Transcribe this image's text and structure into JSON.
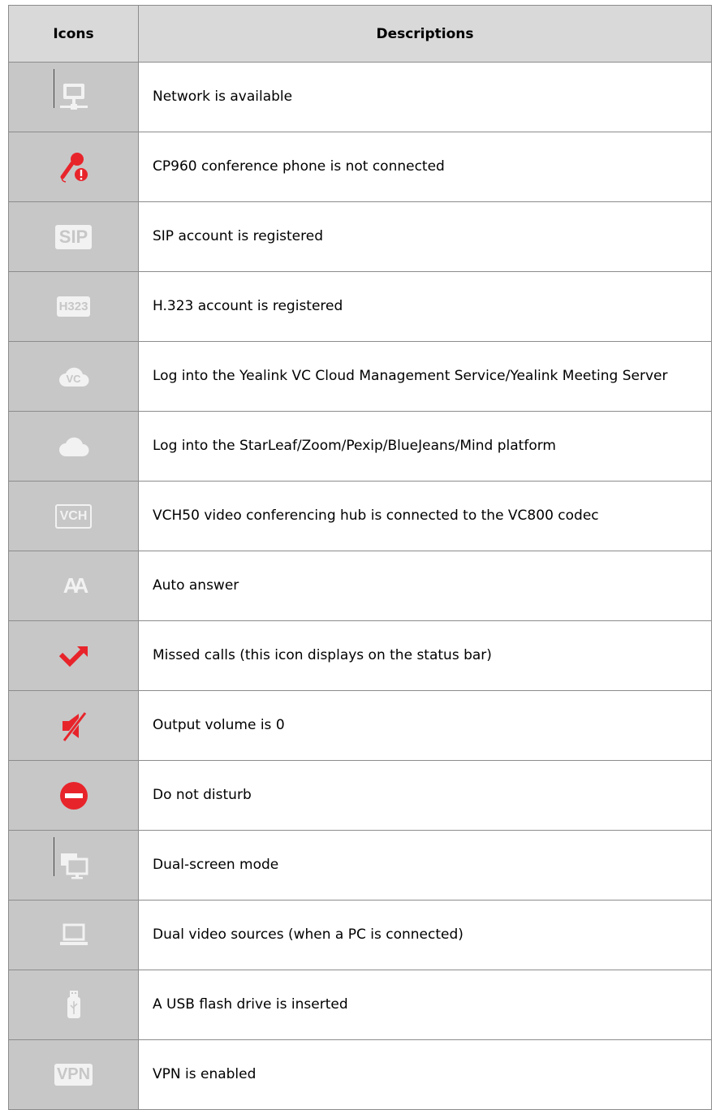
{
  "header": {
    "col_icons": "Icons",
    "col_desc": "Descriptions"
  },
  "colors": {
    "header_bg": "#d9d9d9",
    "icon_bg": "#c7c7c7",
    "red": "#e8242b",
    "icon_white": "#f2f2f2"
  },
  "rows": [
    {
      "icon": "network-icon",
      "desc": "Network is available"
    },
    {
      "icon": "microphone-warning-icon",
      "desc": "CP960 conference phone is not connected"
    },
    {
      "icon": "sip-icon",
      "icon_text": "SIP",
      "desc": "SIP account is registered"
    },
    {
      "icon": "h323-icon",
      "icon_text": "H323",
      "desc": "H.323 account is registered"
    },
    {
      "icon": "vc-cloud-icon",
      "icon_text": "VC",
      "desc": "Log into the Yealink VC Cloud Management Service/Yealink Meeting Server"
    },
    {
      "icon": "cloud-icon",
      "desc": "Log into the StarLeaf/Zoom/Pexip/BlueJeans/Mind platform"
    },
    {
      "icon": "vch-icon",
      "icon_text": "VCH",
      "desc": "VCH50 video conferencing hub is connected to the VC800 codec"
    },
    {
      "icon": "auto-answer-icon",
      "icon_text": "AA",
      "desc": "Auto answer"
    },
    {
      "icon": "missed-call-icon",
      "desc": "Missed calls (this icon displays on the status bar)"
    },
    {
      "icon": "mute-speaker-icon",
      "desc": "Output volume is 0"
    },
    {
      "icon": "do-not-disturb-icon",
      "desc": "Do not disturb"
    },
    {
      "icon": "dual-screen-icon",
      "desc": "Dual-screen mode"
    },
    {
      "icon": "laptop-icon",
      "desc": "Dual video sources (when a PC is connected)"
    },
    {
      "icon": "usb-drive-icon",
      "desc": "A USB flash drive is inserted"
    },
    {
      "icon": "vpn-icon",
      "icon_text": "VPN",
      "desc": "VPN is enabled"
    }
  ]
}
